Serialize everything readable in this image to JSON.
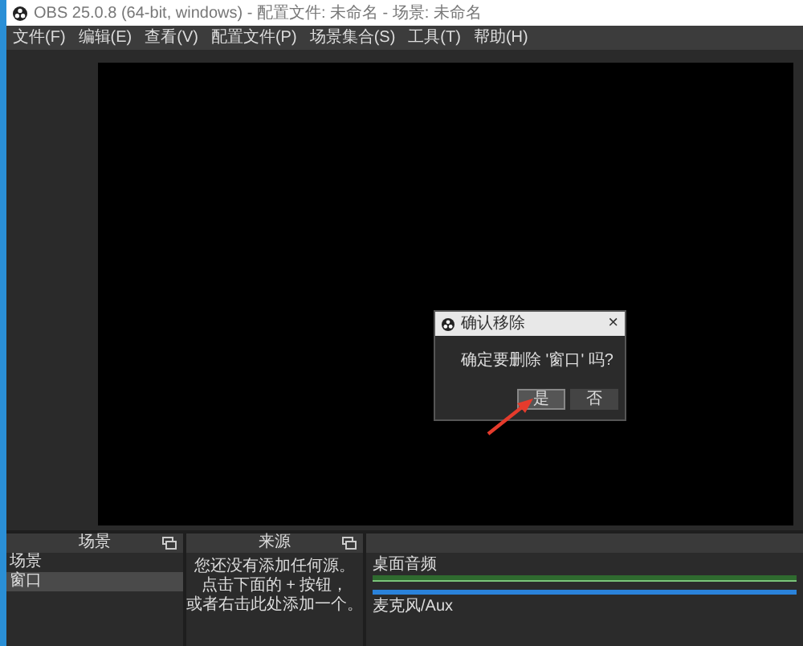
{
  "window": {
    "title": "OBS 25.0.8 (64-bit, windows) - 配置文件: 未命名 - 场景: 未命名"
  },
  "menu": [
    "文件(F)",
    "编辑(E)",
    "查看(V)",
    "配置文件(P)",
    "场景集合(S)",
    "工具(T)",
    "帮助(H)"
  ],
  "dialog": {
    "title": "确认移除",
    "close": "×",
    "message": "确定要删除 '窗口' 吗?",
    "buttons": [
      {
        "label": "是",
        "selected": true
      },
      {
        "label": "否",
        "selected": false
      }
    ]
  },
  "scenes": {
    "title": "场景",
    "items": [
      {
        "label": "场景",
        "selected": false
      },
      {
        "label": "窗口",
        "selected": true
      }
    ]
  },
  "sources": {
    "title": "来源",
    "hint": [
      "您还没有添加任何源。",
      "点击下面的 + 按钮，",
      "或者右击此处添加一个。"
    ]
  },
  "mixer": {
    "channels": [
      {
        "name": "桌面音频",
        "level": 1
      },
      {
        "name": "麦克风/Aux"
      }
    ]
  }
}
